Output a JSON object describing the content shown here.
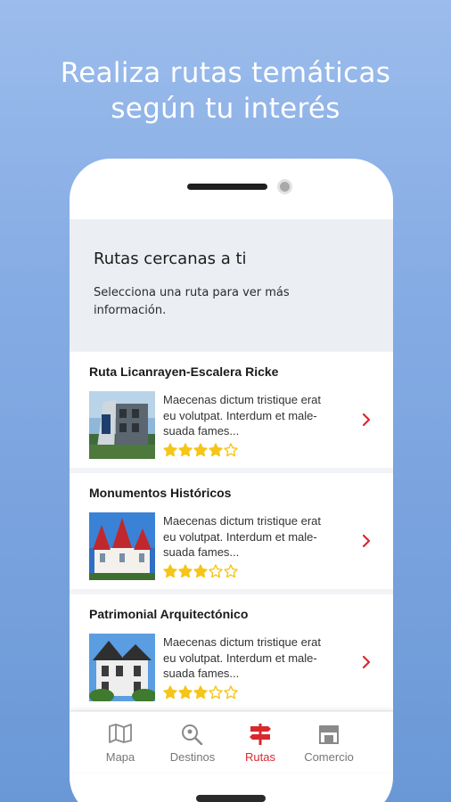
{
  "headline": {
    "line1": "Realiza rutas temáticas",
    "line2": "según tu interés"
  },
  "screen": {
    "title": "Rutas cercanas a ti",
    "subtitle_line1": "Selecciona una ruta para ver más",
    "subtitle_line2": "información."
  },
  "routes": [
    {
      "title": "Ruta Licanrayen-Escalera Ricke",
      "desc_line1": "Maecenas dictum tristique erat",
      "desc_line2": "eu volutpat. Interdum et male-",
      "desc_line3": "suada fames...",
      "rating": 4,
      "max_rating": 5
    },
    {
      "title": "Monumentos Históricos",
      "desc_line1": "Maecenas dictum tristique erat",
      "desc_line2": "eu volutpat. Interdum et male-",
      "desc_line3": "suada fames...",
      "rating": 3,
      "max_rating": 5
    },
    {
      "title": "Patrimonial Arquitectónico",
      "desc_line1": "Maecenas dictum tristique erat",
      "desc_line2": "eu volutpat. Interdum et male-",
      "desc_line3": "suada fames...",
      "rating": 3,
      "max_rating": 5
    }
  ],
  "bottom_nav": {
    "items": [
      {
        "label": "Mapa",
        "icon": "map-icon",
        "active": false
      },
      {
        "label": "Destinos",
        "icon": "search-location-icon",
        "active": false
      },
      {
        "label": "Rutas",
        "icon": "signpost-icon",
        "active": true
      },
      {
        "label": "Comercio",
        "icon": "store-icon",
        "active": false
      }
    ]
  },
  "colors": {
    "accent": "#d8292f",
    "star": "#f5c518",
    "background_top": "#9bbcec",
    "background_bottom": "#6a98d6"
  }
}
